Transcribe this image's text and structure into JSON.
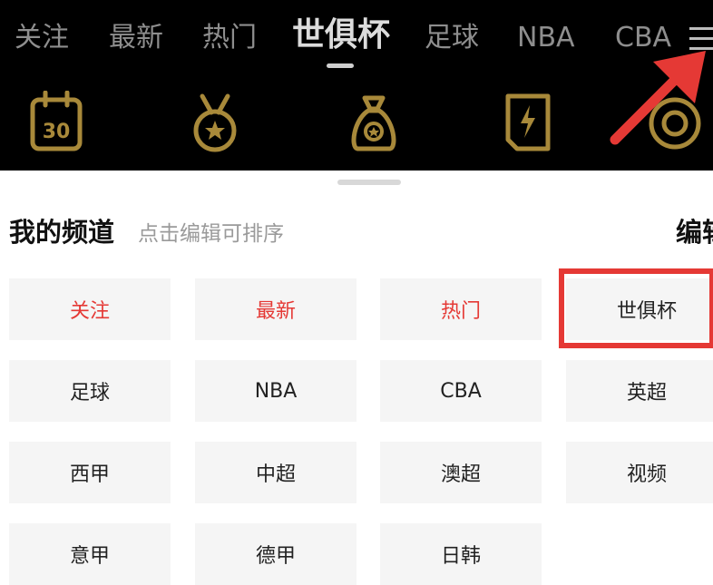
{
  "top_tabs": [
    "关注",
    "最新",
    "热门",
    "世俱杯",
    "足球",
    "NBA",
    "CBA"
  ],
  "active_tab": "世俱杯",
  "category_icons": [
    "calendar-30-icon",
    "medal-icon",
    "money-bag-icon",
    "card-icon",
    "target-icon"
  ],
  "calendar_day": "30",
  "sheet": {
    "title": "我的频道",
    "hint": "点击编辑可排序",
    "edit_label": "编辑"
  },
  "channels": [
    {
      "label": "关注",
      "color": "#e53935"
    },
    {
      "label": "最新",
      "color": "#e53935"
    },
    {
      "label": "热门",
      "color": "#e53935"
    },
    {
      "label": "世俱杯"
    },
    {
      "label": "足球"
    },
    {
      "label": "NBA"
    },
    {
      "label": "CBA"
    },
    {
      "label": "英超"
    },
    {
      "label": "西甲"
    },
    {
      "label": "中超"
    },
    {
      "label": "澳超"
    },
    {
      "label": "视频"
    },
    {
      "label": "意甲"
    },
    {
      "label": "德甲"
    },
    {
      "label": "日韩"
    }
  ],
  "colors": {
    "accent_red": "#e53935",
    "icon_gold": "#a8893a",
    "top_bg": "#000000"
  }
}
